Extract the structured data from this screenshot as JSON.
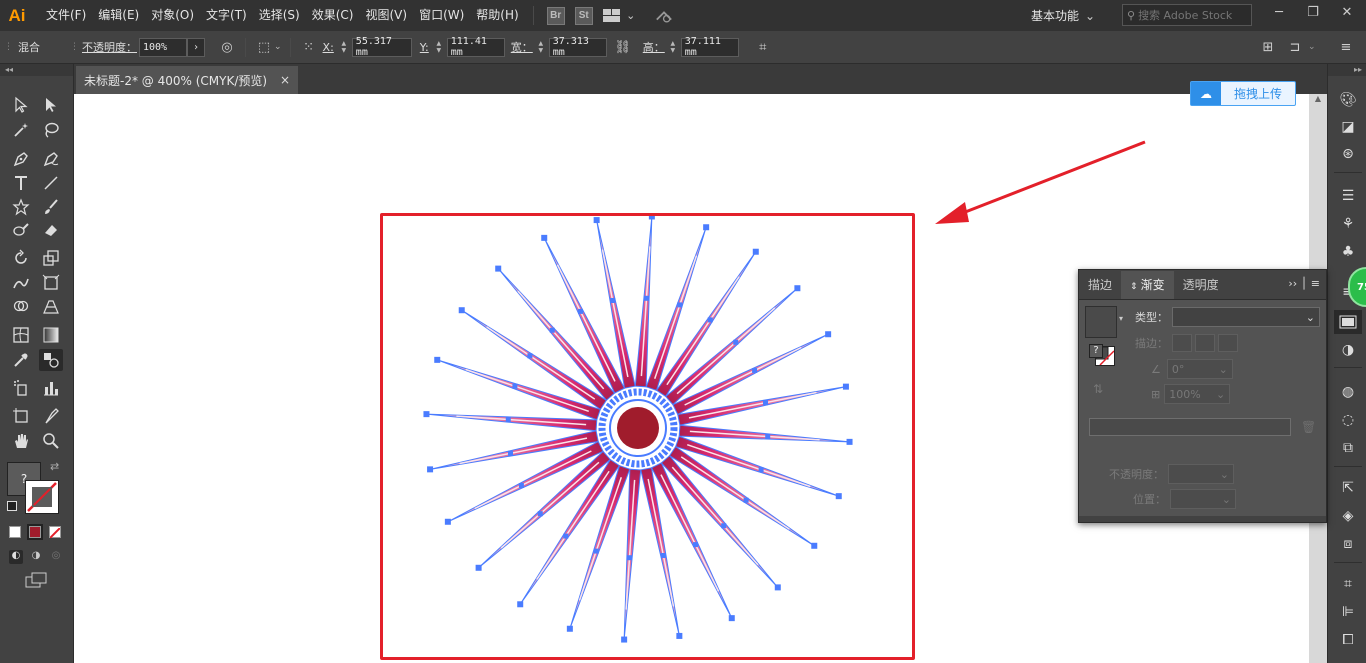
{
  "app": {
    "logo": "Ai"
  },
  "menu": [
    "文件(F)",
    "编辑(E)",
    "对象(O)",
    "文字(T)",
    "选择(S)",
    "效果(C)",
    "视图(V)",
    "窗口(W)",
    "帮助(H)"
  ],
  "menubar_icons": {
    "bridge": "Br",
    "stock": "St"
  },
  "workspace": {
    "label": "基本功能",
    "search_placeholder": "搜索 Adobe Stock"
  },
  "window_controls": {
    "minimize": "─",
    "restore": "❐",
    "close": "✕"
  },
  "control_bar": {
    "mode_label": "混合",
    "opacity_label": "不透明度：",
    "opacity_value": "100%",
    "x_label": "X:",
    "x_value": "55.317 mm",
    "y_label": "Y:",
    "y_value": "111.41 mm",
    "w_label": "宽：",
    "w_value": "37.313 mm",
    "h_label": "高：",
    "h_value": "37.111 mm"
  },
  "document_tab": {
    "title": "未标题-2* @ 400% (CMYK/预览)",
    "close": "×"
  },
  "upload_button": {
    "label": "拖拽上传"
  },
  "badge": {
    "value": "75"
  },
  "gradient_panel": {
    "tabs": [
      "描边",
      "渐变",
      "透明度"
    ],
    "active_tab": 1,
    "type_label": "类型：",
    "stroke_label": "描边：",
    "angle_value": "0°",
    "aspect_value": "100%",
    "opacity_label": "不透明度：",
    "location_label": "位置："
  },
  "toolbar_swatch": {
    "fill_question": "?"
  },
  "artwork": {
    "petal_count": 24,
    "petal_color": "#d8296e",
    "center_color": "#a01c2c",
    "path_color": "#4a7cff"
  },
  "colors": {
    "accent_red": "#e3202a",
    "upload_blue": "#2e8fe8",
    "badge_green": "#2bbd4a"
  }
}
